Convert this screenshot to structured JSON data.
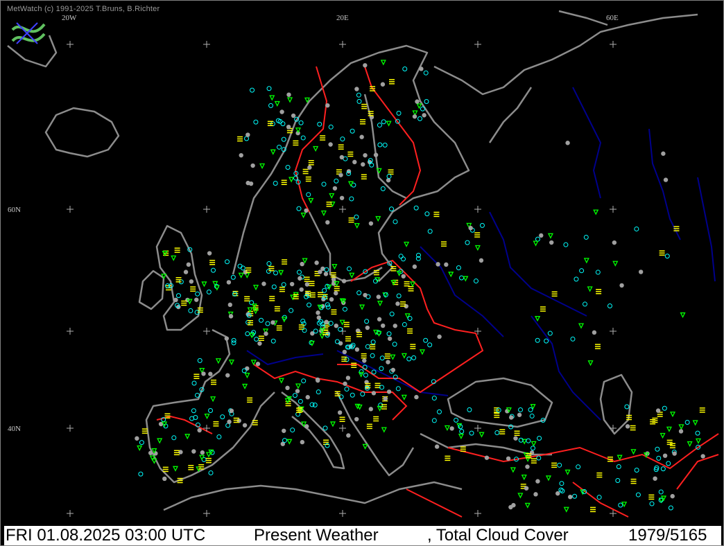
{
  "copyright": "MetWatch  (c) 1991-2025 T.Bruns, B.Richter",
  "grid_labels": {
    "lon_20w": "20W",
    "lon_20e": "20E",
    "lon_60e": "60E",
    "lat_60n": "60N",
    "lat_40n": "40N"
  },
  "status": {
    "datetime": "FRI 01.08.2025 03:00 UTC",
    "product": "Present Weather",
    "overlay": ", Total Cloud Cover",
    "station_count": "1979/5165"
  },
  "legend_colors": {
    "background": "#000000",
    "coastline": "#8c8c8c",
    "borders": "#ff0000",
    "rivers": "#00008b",
    "clear_ok": "#00ffff",
    "haze_fog": "#ffff00",
    "precip_showers": "#00ff00",
    "cloud_cover": "#a0a0a0"
  }
}
